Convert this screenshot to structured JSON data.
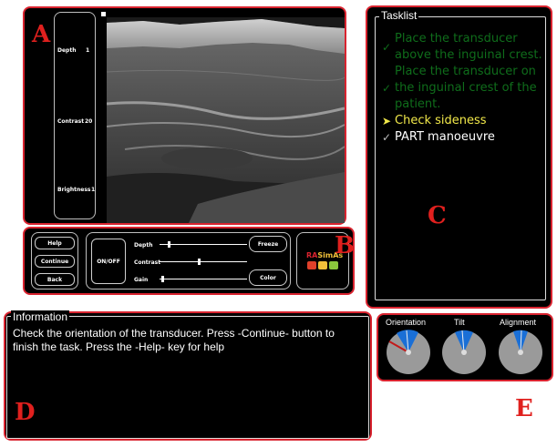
{
  "panel_letters": {
    "a": "A",
    "b": "B",
    "c": "C",
    "d": "D",
    "e": "E"
  },
  "image_panel": {
    "depth_label": "Depth",
    "depth_value": "1",
    "contrast_label": "Contrast",
    "contrast_value": "20",
    "brightness_label": "Brightness",
    "brightness_value": "1"
  },
  "controls": {
    "help_label": "Help",
    "continue_label": "Continue",
    "back_label": "Back",
    "onoff_label": "ON/OFF",
    "depth_slider_label": "Depth",
    "contrast_slider_label": "Contrast",
    "gain_slider_label": "Gain",
    "freeze_label": "Freeze",
    "color_label": "Color",
    "sliders": {
      "depth": 0.1,
      "contrast": 0.45,
      "gain": 0.02
    },
    "logo_text_1": "RA",
    "logo_text_2": "SimAs"
  },
  "tasklist": {
    "title": "Tasklist",
    "items": [
      {
        "status": "done",
        "text": "Place the transducer above the inguinal crest."
      },
      {
        "status": "done",
        "text": "Place the transducer on the inguinal crest of the patient."
      },
      {
        "status": "current",
        "text": "Check sideness"
      },
      {
        "status": "pending",
        "text": "PART manoeuvre"
      }
    ],
    "done_color": "#0f6d1b",
    "current_color": "#f2e94a",
    "pending_color": "#ffffff"
  },
  "information": {
    "title": "Information",
    "text": "Check the orientation of the transducer. Press -Continue- button to finish the task. Press the -Help- key for help"
  },
  "gauges": {
    "orientation_label": "Orientation",
    "tilt_label": "Tilt",
    "alignment_label": "Alignment",
    "target_color": "#1a6fd6",
    "needle_color": "#c21a1a"
  },
  "colors": {
    "accent_red": "#d9232f"
  }
}
